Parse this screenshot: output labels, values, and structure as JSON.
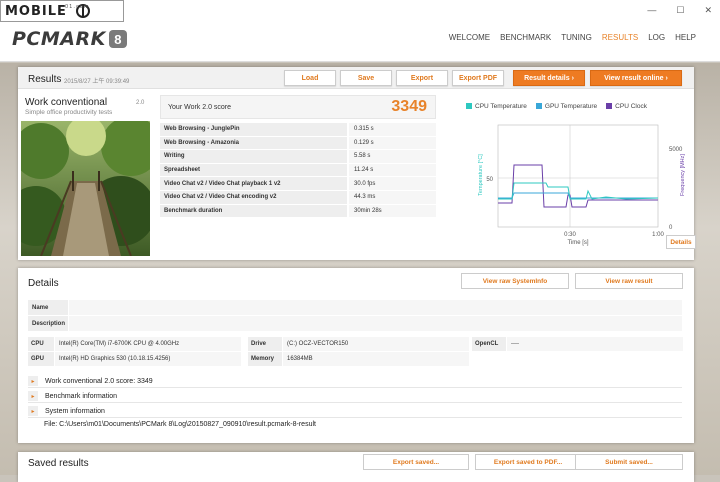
{
  "window": {
    "minimize": "—",
    "maximize": "☐",
    "close": "✕"
  },
  "watermark": {
    "text": "MOBILE",
    "tag": "01.com"
  },
  "brand": {
    "name": "PCMARK",
    "version_glyph": "8"
  },
  "nav": [
    "WELCOME",
    "BENCHMARK",
    "TUNING",
    "RESULTS",
    "LOG",
    "HELP"
  ],
  "nav_active": "RESULTS",
  "results": {
    "title": "Results",
    "date": "2015/8/27 上午 09:39:49",
    "buttons": {
      "load": "Load",
      "save": "Save",
      "export": "Export",
      "export_pdf": "Export PDF"
    },
    "result_details": "Result details",
    "view_online": "View result online",
    "workload": {
      "title": "Work conventional",
      "subtitle": "Simple office productivity tests",
      "version": "2.0"
    },
    "score_label": "Your Work 2.0 score",
    "score": "3349",
    "rows": [
      {
        "k": "Web Browsing - JunglePin",
        "v": "0.315 s"
      },
      {
        "k": "Web Browsing - Amazonia",
        "v": "0.129 s"
      },
      {
        "k": "Writing",
        "v": "5.58 s"
      },
      {
        "k": "Spreadsheet",
        "v": "11.24 s"
      },
      {
        "k": "Video Chat v2 / Video Chat playback 1 v2",
        "v": "30.0 fps"
      },
      {
        "k": "Video Chat v2 / Video Chat encoding v2",
        "v": "44.3 ms"
      },
      {
        "k": "Benchmark duration",
        "v": "30min 28s"
      }
    ],
    "chart": {
      "legend": [
        "CPU Temperature",
        "GPU Temperature",
        "CPU Clock"
      ],
      "colors": {
        "cpu_temp": "#2ec8c0",
        "gpu_temp": "#39a7d8",
        "cpu_clock": "#6a3fa8"
      },
      "y_left_label": "Temperature [°C]",
      "y_left_tick": "50",
      "y_right_label": "Frequency [MHz]",
      "y_right_ticks": [
        "5000",
        "0"
      ],
      "x_label": "Time [s]",
      "x_ticks": [
        "0:30",
        "1:00"
      ],
      "details_button": "Details"
    }
  },
  "details": {
    "title": "Details",
    "view_sysinfo": "View raw SystemInfo",
    "view_result": "View raw result",
    "name_label": "Name",
    "desc_label": "Description",
    "cpu_label": "CPU",
    "cpu": "Intel(R) Core(TM) i7-6700K CPU @ 4.00GHz",
    "gpu_label": "GPU",
    "gpu": "Intel(R) HD Graphics 530 (10.18.15.4256)",
    "drive_label": "Drive",
    "drive": "(C:) OCZ-VECTOR150",
    "memory_label": "Memory",
    "memory": "16384MB",
    "opencl_label": "OpenCL",
    "opencl": "----",
    "expand": [
      "Work conventional 2.0 score: 3349",
      "Benchmark information",
      "System information"
    ],
    "file": "File: C:\\Users\\m01\\Documents\\PCMark 8\\Log\\20150827_090910\\result.pcmark-8-result"
  },
  "saved": {
    "title": "Saved results",
    "export_saved": "Export saved...",
    "export_pdf": "Export saved to PDF...",
    "submit": "Submit saved..."
  }
}
